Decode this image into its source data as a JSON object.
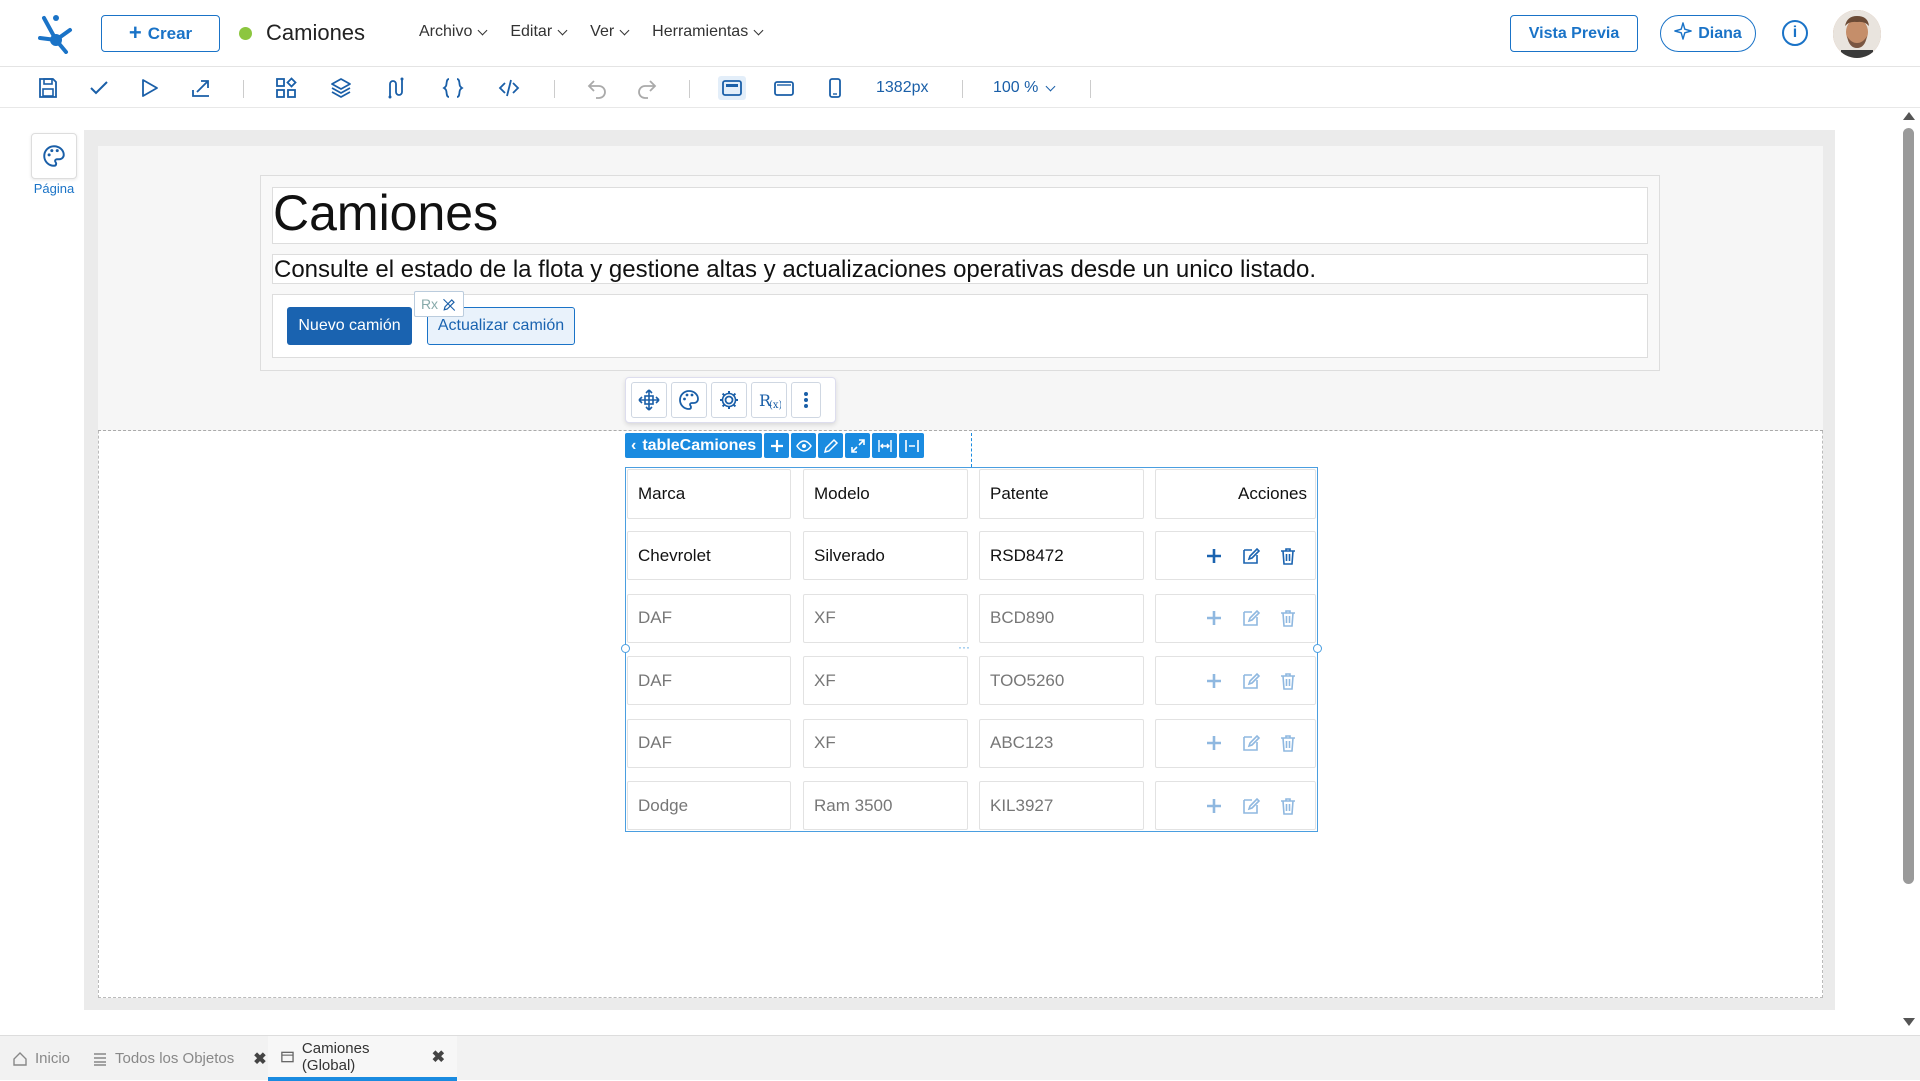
{
  "header": {
    "crear_label": "Crear",
    "doc_title": "Camiones",
    "status_color": "#8cc63f",
    "menu": [
      {
        "label": "Archivo"
      },
      {
        "label": "Editar"
      },
      {
        "label": "Ver"
      },
      {
        "label": "Herramientas"
      }
    ],
    "vista_previa_label": "Vista Previa",
    "assistant_label": "Diana",
    "info_label": "i"
  },
  "toolbar": {
    "width_label": "1382px",
    "zoom_label": "100 %"
  },
  "left_panel": {
    "pagina_label": "Página"
  },
  "page": {
    "title": "Camiones",
    "subtitle": "Consulte el estado de la flota y gestione altas y actualizaciones operativas desde un unico listado.",
    "primary_button": "Nuevo camión",
    "secondary_button": "Actualizar camión",
    "rx_tag": "Rx"
  },
  "selection": {
    "component_name": "tableCamiones"
  },
  "table": {
    "columns": [
      "Marca",
      "Modelo",
      "Patente",
      "Acciones"
    ],
    "rows": [
      {
        "marca": "Chevrolet",
        "modelo": "Silverado",
        "patente": "RSD8472"
      },
      {
        "marca": "DAF",
        "modelo": "XF",
        "patente": "BCD890"
      },
      {
        "marca": "DAF",
        "modelo": "XF",
        "patente": "TOO5260"
      },
      {
        "marca": "DAF",
        "modelo": "XF",
        "patente": "ABC123"
      },
      {
        "marca": "Dodge",
        "modelo": "Ram 3500",
        "patente": "KIL3927"
      }
    ]
  },
  "bottom_tabs": [
    {
      "label": "Inicio"
    },
    {
      "label": "Todos los Objetos"
    },
    {
      "label": "Camiones (Global)"
    }
  ],
  "colors": {
    "accent": "#1a73c7",
    "selection": "#1a8be0",
    "primary_button": "#1a63b0"
  }
}
